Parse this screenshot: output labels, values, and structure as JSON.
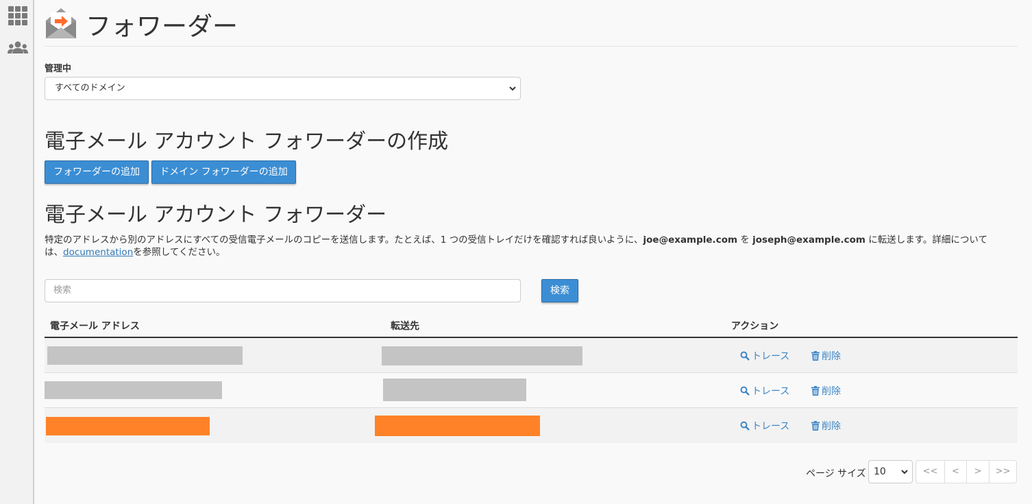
{
  "header": {
    "title": "フォワーダー"
  },
  "managing": {
    "label": "管理中",
    "selected": "すべてのドメイン"
  },
  "create_section": {
    "heading": "電子メール アカウント フォワーダーの作成",
    "add_forwarder_label": "フォワーダーの追加",
    "add_domain_forwarder_label": "ドメイン フォワーダーの追加"
  },
  "list_section": {
    "heading": "電子メール アカウント フォワーダー",
    "description": {
      "part1": "特定のアドレスから別のアドレスにすべての受信電子メールのコピーを送信します。たとえば、1 つの受信トレイだけを確認すれば良いように、",
      "email1": "joe@example.com",
      "part2": " を ",
      "email2": "joseph@example.com",
      "part3": " に転送します。詳細については、",
      "link": "documentation",
      "part4": "を参照してください。"
    }
  },
  "search": {
    "placeholder": "検索",
    "button_label": "検索"
  },
  "table": {
    "columns": [
      "電子メール アドレス",
      "転送先",
      "アクション"
    ],
    "rows": [
      {
        "redaction_color": "#c4c4c4",
        "trace_label": "トレース",
        "delete_label": "削除"
      },
      {
        "redaction_color": "#c4c4c4",
        "trace_label": "トレース",
        "delete_label": "削除"
      },
      {
        "redaction_color": "#ff8228",
        "trace_label": "トレース",
        "delete_label": "削除"
      }
    ]
  },
  "pagination": {
    "page_size_label": "ページ サイズ",
    "page_size": "10",
    "first": "<<",
    "prev": "<",
    "next": ">",
    "last": ">>"
  },
  "colors": {
    "primary_button": "#3b8ed4",
    "link": "#3d85c6",
    "redaction_gray": "#c4c4c4",
    "redaction_orange": "#ff8228"
  },
  "icons": {
    "sidebar": [
      "grid-icon",
      "users-icon"
    ],
    "header": "email-forward-icon",
    "row_actions": [
      "search-icon",
      "trash-icon"
    ]
  }
}
